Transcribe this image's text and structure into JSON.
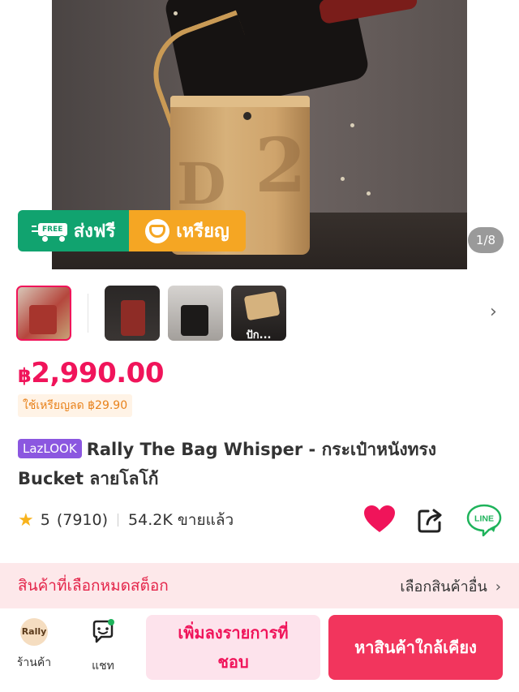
{
  "hero": {
    "promo_free_badge": "FREE",
    "promo_free_label": "ส่งฟรี",
    "promo_coin_label": "เหรียญ",
    "image_counter": "1/8"
  },
  "thumbnails": {
    "overlay_text": "ปัก..."
  },
  "product": {
    "price": "2,990.00",
    "currency_symbol": "฿",
    "coin_discount": "ใช้เหรียญลด ฿29.90",
    "badge": "LazLOOK",
    "title": "Rally The Bag Whisper - กระเป๋าหนังทรง Bucket ลายโลโก้",
    "rating": "5",
    "review_count": "(7910)",
    "sold": "54.2K ขายแล้ว",
    "line_label": "LINE"
  },
  "stock_banner": {
    "message": "สินค้าที่เลือกหมดสต็อก",
    "link": "เลือกสินค้าอื่น"
  },
  "bottom_bar": {
    "store_logo_text": "Rally",
    "store_label": "ร้านค้า",
    "chat_label": "แชท",
    "wishlist_button": "เพิ่มลงรายการที่ชอบ",
    "nearby_button": "หาสินค้าใกล้เคียง"
  },
  "colors": {
    "accent": "#f0145a",
    "free_green": "#11a36f",
    "coin_orange": "#f5a623",
    "lazlook_purple": "#8b57e0",
    "stock_banner_bg": "#fde8ea",
    "primary_button": "#f2355d"
  }
}
